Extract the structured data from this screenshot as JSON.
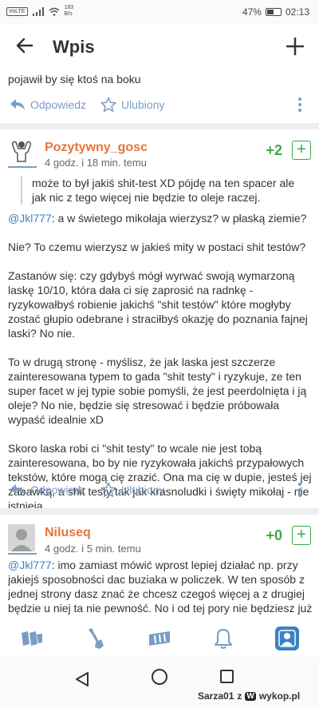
{
  "statusbar": {
    "network_badge": "VoLTE",
    "speed_value": "183",
    "speed_unit": "B/s",
    "battery": "47%",
    "time": "02:13"
  },
  "appbar": {
    "title": "Wpis",
    "back_icon": "arrow-left-icon",
    "add_icon": "plus-icon"
  },
  "previous_comment": {
    "text_tail": "pojawił by się ktoś na boku"
  },
  "actions": {
    "reply_label": "Odpowiedz",
    "favorite_label": "Ulubiony"
  },
  "comments": [
    {
      "author": "Pozytywny_gosc",
      "meta": "4 godz. i 18 min. temu",
      "votes": "+2",
      "quote": "może to był jakiś shit-test XD pójdę na ten spacer ale jak nic z tego więcej nie będzie to oleje raczej.",
      "mention": "@Jkl777",
      "p1_rest": ": a w świetego mikołaja wierzysz? w płaską ziemie?",
      "p2": "Nie? To czemu wierzysz w jakieś mity w postaci shit testów?",
      "p3": "Zastanów się: czy gdybyś mógł wyrwać swoją wymarzoną laskę 10/10, która dała ci się zaprosić na radnkę - ryzykowałbyś robienie jakichś \"shit testów\" które mogłyby zostać głupio odebrane i straciłbyś okazję do poznania fajnej laski? No nie.",
      "p4": "To w drugą stronę - myślisz, że jak laska jest szczerze zainteresowana typem to gada \"shit testy\" i ryzykuje, ze ten super facet w jej typie sobie pomyśli, że jest peerdolnięta i ją oleje? No nie, będzie się stresować i będzie próbowała wypaść idealnie xD",
      "p5": "Skoro laska robi ci \"shit testy\" to wcale nie jest tobą zainteresowana, bo by nie ryzykowała jakichś przypałowych tekstów, które mogą cię zrazić. Ona ma cię w dupie, jesteś jej zabawką, a shit testy tak jak krasnoludki i święty mikołaj - nie istnieją"
    },
    {
      "author": "Niluseq",
      "meta": "4 godz. i 5 min. temu",
      "votes": "+0",
      "mention": "@Jkl777",
      "text_rest": ": imo zamiast mówić wprost lepiej działać np. przy jakiejś sposobności dac buziaka w policzek. W ten sposób z jednej strony dasz znać że chcesz czegoś więcej a z drugiej będzie u niej ta nie pewność. No i od tej pory nie będziesz już"
    }
  ],
  "bottomnav": [
    "home-icon",
    "shovel-icon",
    "mikroblog-icon",
    "bell-icon",
    "profile-icon"
  ],
  "watermark": {
    "user": "Sarza01",
    "z": "z",
    "site": "wykop.pl"
  },
  "colors": {
    "accent": "#3b82c4",
    "author": "#e8743b",
    "vote": "#3daa4a",
    "action": "#7a9cc6"
  }
}
